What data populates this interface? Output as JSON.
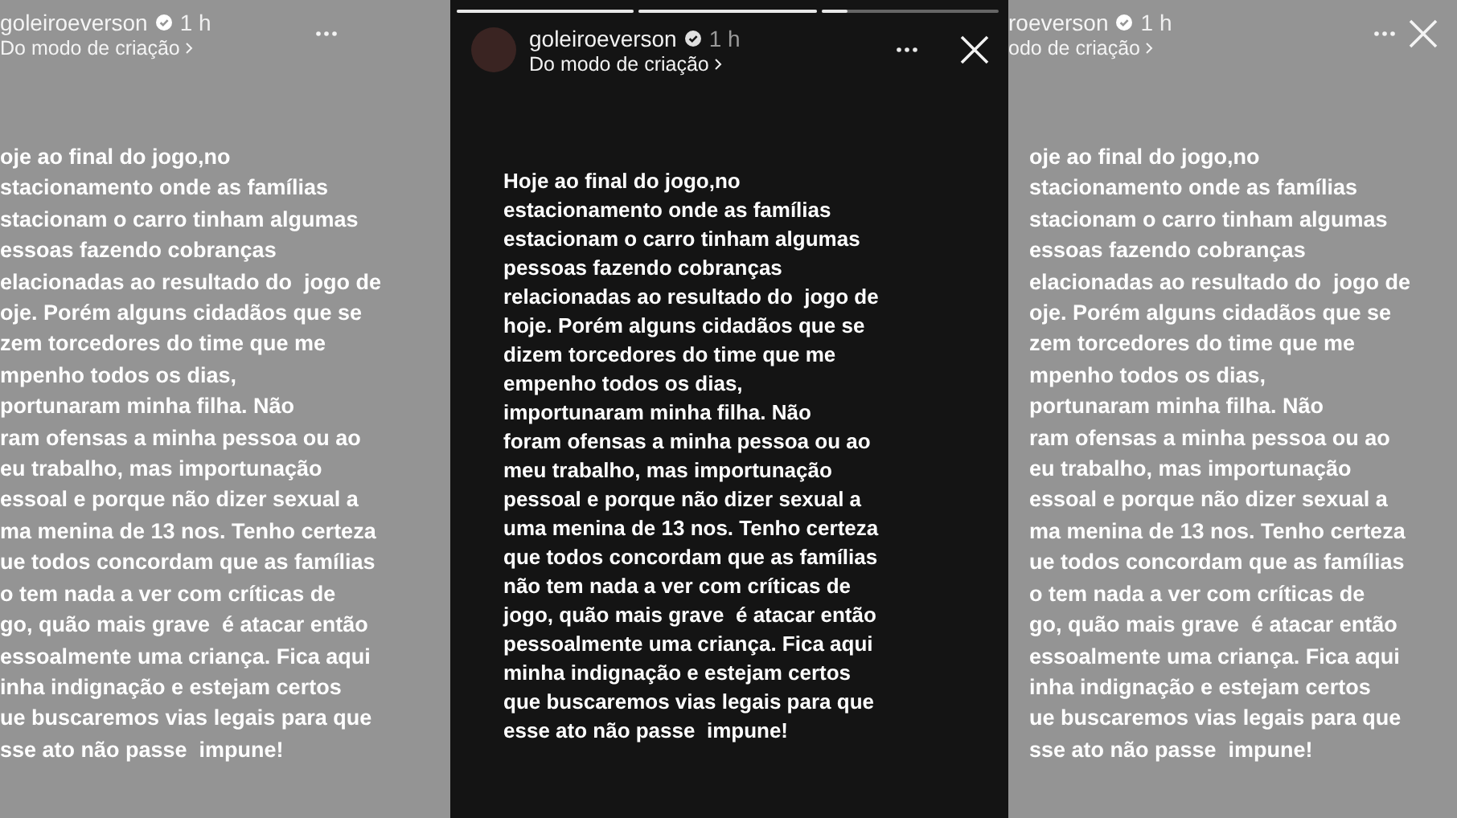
{
  "left_backdrop": {
    "username": "goleiroeverson",
    "time": "1 h",
    "subtitle": "Do modo de criação",
    "text_lines": [
      "oje ao final do jogo,no",
      "stacionamento onde as famílias",
      "stacionam o carro tinham algumas",
      "essoas fazendo cobranças",
      "elacionadas ao resultado do  jogo de",
      "oje. Porém alguns cidadãos que se",
      "zem torcedores do time que me",
      "mpenho todos os dias,",
      "portunaram minha filha. Não",
      "ram ofensas a minha pessoa ou ao",
      "eu trabalho, mas importunação",
      "essoal e porque não dizer sexual a",
      "ma menina de 13 nos. Tenho certeza",
      "ue todos concordam que as famílias",
      "o tem nada a ver com críticas de",
      "go, quão mais grave  é atacar então",
      "essoalmente uma criança. Fica aqui",
      "inha indignação e estejam certos",
      "ue buscaremos vias legais para que",
      "sse ato não passe  impune!"
    ]
  },
  "story": {
    "progress": [
      {
        "level": 1
      },
      {
        "level": 1
      },
      {
        "level": 0.15
      }
    ],
    "username": "goleiroeverson",
    "verified": true,
    "time": "1 h",
    "subtitle": "Do modo de criação",
    "text_lines": [
      "Hoje ao final do jogo,no",
      "estacionamento onde as famílias",
      "estacionam o carro tinham algumas",
      "pessoas fazendo cobranças",
      "relacionadas ao resultado do  jogo de",
      "hoje. Porém alguns cidadãos que se",
      "dizem torcedores do time que me",
      "empenho todos os dias,",
      "importunaram minha filha. Não",
      "foram ofensas a minha pessoa ou ao",
      "meu trabalho, mas importunação",
      "pessoal e porque não dizer sexual a",
      "uma menina de 13 nos. Tenho certeza",
      "que todos concordam que as famílias",
      "não tem nada a ver com críticas de",
      "jogo, quão mais grave  é atacar então",
      "pessoalmente uma criança. Fica aqui",
      "minha indignação e estejam certos",
      "que buscaremos vias legais para que",
      "esse ato não passe  impune!"
    ]
  },
  "right_backdrop": {
    "username": "roeverson",
    "time": "1 h",
    "subtitle": "odo de criação",
    "text_lines": [
      "oje ao final do jogo,no",
      "stacionamento onde as famílias",
      "stacionam o carro tinham algumas",
      "essoas fazendo cobranças",
      "elacionadas ao resultado do  jogo de",
      "oje. Porém alguns cidadãos que se",
      "zem torcedores do time que me",
      "mpenho todos os dias,",
      "portunaram minha filha. Não",
      "ram ofensas a minha pessoa ou ao",
      "eu trabalho, mas importunação",
      "essoal e porque não dizer sexual a",
      "ma menina de 13 nos. Tenho certeza",
      "ue todos concordam que as famílias",
      "o tem nada a ver com críticas de",
      "go, quão mais grave  é atacar então",
      "essoalmente uma criança. Fica aqui",
      "inha indignação e estejam certos",
      "ue buscaremos vias legais para que",
      "sse ato não passe  impune!"
    ]
  }
}
